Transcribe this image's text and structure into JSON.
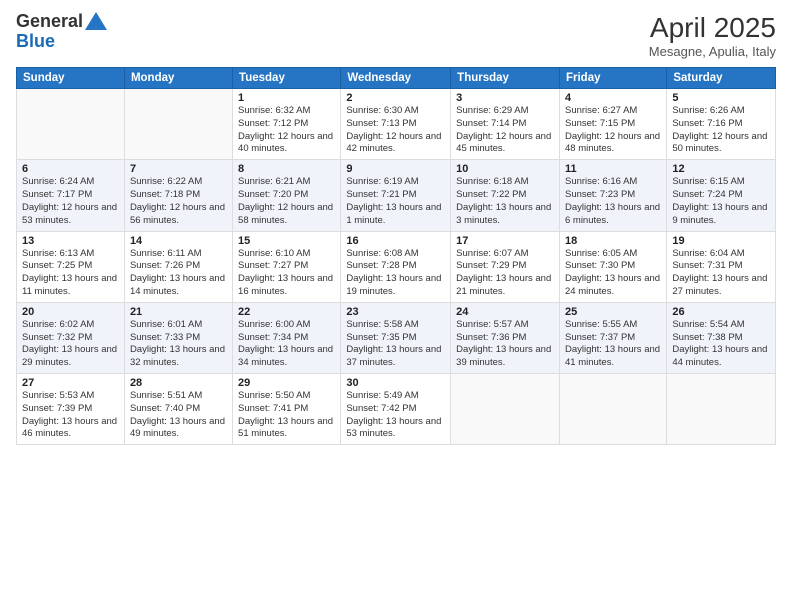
{
  "logo": {
    "general": "General",
    "blue": "Blue"
  },
  "header": {
    "month": "April 2025",
    "location": "Mesagne, Apulia, Italy"
  },
  "weekdays": [
    "Sunday",
    "Monday",
    "Tuesday",
    "Wednesday",
    "Thursday",
    "Friday",
    "Saturday"
  ],
  "weeks": [
    [
      {
        "day": "",
        "sunrise": "",
        "sunset": "",
        "daylight": ""
      },
      {
        "day": "",
        "sunrise": "",
        "sunset": "",
        "daylight": ""
      },
      {
        "day": "1",
        "sunrise": "Sunrise: 6:32 AM",
        "sunset": "Sunset: 7:12 PM",
        "daylight": "Daylight: 12 hours and 40 minutes."
      },
      {
        "day": "2",
        "sunrise": "Sunrise: 6:30 AM",
        "sunset": "Sunset: 7:13 PM",
        "daylight": "Daylight: 12 hours and 42 minutes."
      },
      {
        "day": "3",
        "sunrise": "Sunrise: 6:29 AM",
        "sunset": "Sunset: 7:14 PM",
        "daylight": "Daylight: 12 hours and 45 minutes."
      },
      {
        "day": "4",
        "sunrise": "Sunrise: 6:27 AM",
        "sunset": "Sunset: 7:15 PM",
        "daylight": "Daylight: 12 hours and 48 minutes."
      },
      {
        "day": "5",
        "sunrise": "Sunrise: 6:26 AM",
        "sunset": "Sunset: 7:16 PM",
        "daylight": "Daylight: 12 hours and 50 minutes."
      }
    ],
    [
      {
        "day": "6",
        "sunrise": "Sunrise: 6:24 AM",
        "sunset": "Sunset: 7:17 PM",
        "daylight": "Daylight: 12 hours and 53 minutes."
      },
      {
        "day": "7",
        "sunrise": "Sunrise: 6:22 AM",
        "sunset": "Sunset: 7:18 PM",
        "daylight": "Daylight: 12 hours and 56 minutes."
      },
      {
        "day": "8",
        "sunrise": "Sunrise: 6:21 AM",
        "sunset": "Sunset: 7:20 PM",
        "daylight": "Daylight: 12 hours and 58 minutes."
      },
      {
        "day": "9",
        "sunrise": "Sunrise: 6:19 AM",
        "sunset": "Sunset: 7:21 PM",
        "daylight": "Daylight: 13 hours and 1 minute."
      },
      {
        "day": "10",
        "sunrise": "Sunrise: 6:18 AM",
        "sunset": "Sunset: 7:22 PM",
        "daylight": "Daylight: 13 hours and 3 minutes."
      },
      {
        "day": "11",
        "sunrise": "Sunrise: 6:16 AM",
        "sunset": "Sunset: 7:23 PM",
        "daylight": "Daylight: 13 hours and 6 minutes."
      },
      {
        "day": "12",
        "sunrise": "Sunrise: 6:15 AM",
        "sunset": "Sunset: 7:24 PM",
        "daylight": "Daylight: 13 hours and 9 minutes."
      }
    ],
    [
      {
        "day": "13",
        "sunrise": "Sunrise: 6:13 AM",
        "sunset": "Sunset: 7:25 PM",
        "daylight": "Daylight: 13 hours and 11 minutes."
      },
      {
        "day": "14",
        "sunrise": "Sunrise: 6:11 AM",
        "sunset": "Sunset: 7:26 PM",
        "daylight": "Daylight: 13 hours and 14 minutes."
      },
      {
        "day": "15",
        "sunrise": "Sunrise: 6:10 AM",
        "sunset": "Sunset: 7:27 PM",
        "daylight": "Daylight: 13 hours and 16 minutes."
      },
      {
        "day": "16",
        "sunrise": "Sunrise: 6:08 AM",
        "sunset": "Sunset: 7:28 PM",
        "daylight": "Daylight: 13 hours and 19 minutes."
      },
      {
        "day": "17",
        "sunrise": "Sunrise: 6:07 AM",
        "sunset": "Sunset: 7:29 PM",
        "daylight": "Daylight: 13 hours and 21 minutes."
      },
      {
        "day": "18",
        "sunrise": "Sunrise: 6:05 AM",
        "sunset": "Sunset: 7:30 PM",
        "daylight": "Daylight: 13 hours and 24 minutes."
      },
      {
        "day": "19",
        "sunrise": "Sunrise: 6:04 AM",
        "sunset": "Sunset: 7:31 PM",
        "daylight": "Daylight: 13 hours and 27 minutes."
      }
    ],
    [
      {
        "day": "20",
        "sunrise": "Sunrise: 6:02 AM",
        "sunset": "Sunset: 7:32 PM",
        "daylight": "Daylight: 13 hours and 29 minutes."
      },
      {
        "day": "21",
        "sunrise": "Sunrise: 6:01 AM",
        "sunset": "Sunset: 7:33 PM",
        "daylight": "Daylight: 13 hours and 32 minutes."
      },
      {
        "day": "22",
        "sunrise": "Sunrise: 6:00 AM",
        "sunset": "Sunset: 7:34 PM",
        "daylight": "Daylight: 13 hours and 34 minutes."
      },
      {
        "day": "23",
        "sunrise": "Sunrise: 5:58 AM",
        "sunset": "Sunset: 7:35 PM",
        "daylight": "Daylight: 13 hours and 37 minutes."
      },
      {
        "day": "24",
        "sunrise": "Sunrise: 5:57 AM",
        "sunset": "Sunset: 7:36 PM",
        "daylight": "Daylight: 13 hours and 39 minutes."
      },
      {
        "day": "25",
        "sunrise": "Sunrise: 5:55 AM",
        "sunset": "Sunset: 7:37 PM",
        "daylight": "Daylight: 13 hours and 41 minutes."
      },
      {
        "day": "26",
        "sunrise": "Sunrise: 5:54 AM",
        "sunset": "Sunset: 7:38 PM",
        "daylight": "Daylight: 13 hours and 44 minutes."
      }
    ],
    [
      {
        "day": "27",
        "sunrise": "Sunrise: 5:53 AM",
        "sunset": "Sunset: 7:39 PM",
        "daylight": "Daylight: 13 hours and 46 minutes."
      },
      {
        "day": "28",
        "sunrise": "Sunrise: 5:51 AM",
        "sunset": "Sunset: 7:40 PM",
        "daylight": "Daylight: 13 hours and 49 minutes."
      },
      {
        "day": "29",
        "sunrise": "Sunrise: 5:50 AM",
        "sunset": "Sunset: 7:41 PM",
        "daylight": "Daylight: 13 hours and 51 minutes."
      },
      {
        "day": "30",
        "sunrise": "Sunrise: 5:49 AM",
        "sunset": "Sunset: 7:42 PM",
        "daylight": "Daylight: 13 hours and 53 minutes."
      },
      {
        "day": "",
        "sunrise": "",
        "sunset": "",
        "daylight": ""
      },
      {
        "day": "",
        "sunrise": "",
        "sunset": "",
        "daylight": ""
      },
      {
        "day": "",
        "sunrise": "",
        "sunset": "",
        "daylight": ""
      }
    ]
  ]
}
